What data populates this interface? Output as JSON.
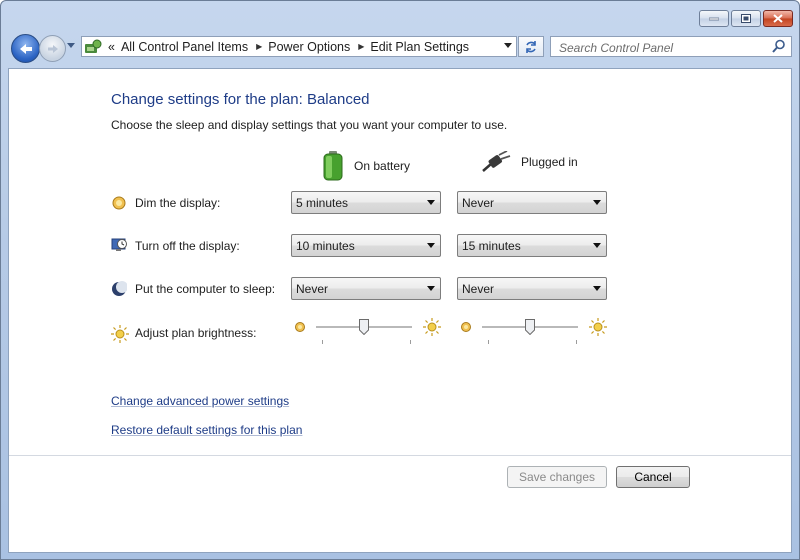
{
  "window": {
    "caption_buttons": [
      "minimize",
      "maximize",
      "close"
    ]
  },
  "nav": {
    "back_icon": "back-arrow-icon",
    "forward_icon": "forward-arrow-icon",
    "overflow": "«",
    "breadcrumb": [
      "All Control Panel Items",
      "Power Options",
      "Edit Plan Settings"
    ],
    "search_placeholder": "Search Control Panel"
  },
  "page": {
    "title": "Change settings for the plan: Balanced",
    "subtitle": "Choose the sleep and display settings that you want your computer to use.",
    "columns": {
      "battery": "On battery",
      "plugged": "Plugged in"
    },
    "rows": [
      {
        "label": "Dim the display:",
        "icon": "dim-display-icon",
        "battery": "5 minutes",
        "plugged": "Never"
      },
      {
        "label": "Turn off the display:",
        "icon": "monitor-clock-icon",
        "battery": "10 minutes",
        "plugged": "15 minutes"
      },
      {
        "label": "Put the computer to sleep:",
        "icon": "moon-sleep-icon",
        "battery": "Never",
        "plugged": "Never"
      }
    ],
    "brightness": {
      "label": "Adjust plan brightness:",
      "battery_level": 0.5,
      "plugged_level": 0.5
    },
    "links": {
      "advanced": "Change advanced power settings",
      "restore": "Restore default settings for this plan"
    },
    "buttons": {
      "save": "Save changes",
      "cancel": "Cancel"
    }
  },
  "colors": {
    "title_blue": "#1e3c87",
    "link_blue": "#1e3c87",
    "frame": "#b7cbe6"
  }
}
